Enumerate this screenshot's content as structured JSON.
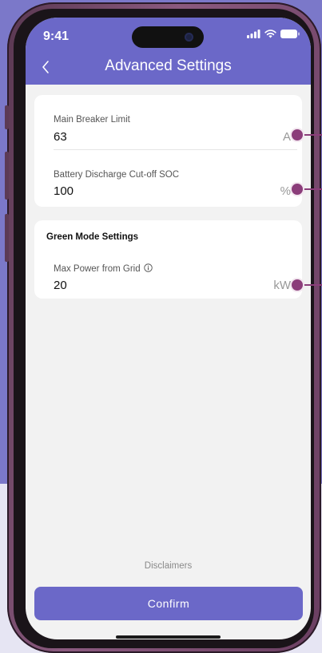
{
  "status_bar": {
    "time": "9:41",
    "icons": [
      "signal-bars-icon",
      "wifi-icon",
      "battery-icon"
    ]
  },
  "header": {
    "title": "Advanced Settings",
    "back_icon": "chevron-left-icon"
  },
  "settings_card": {
    "fields": [
      {
        "label": "Main Breaker Limit",
        "value": "63",
        "unit": "A"
      },
      {
        "label": "Battery Discharge Cut-off SOC",
        "value": "100",
        "unit": "%"
      }
    ]
  },
  "green_mode_card": {
    "title": "Green Mode Settings",
    "fields": [
      {
        "label": "Max Power from Grid",
        "value": "20",
        "unit": "kW",
        "info_icon": "info-circle-icon"
      }
    ]
  },
  "footer": {
    "disclaimers_label": "Disclaimers",
    "confirm_label": "Confirm"
  },
  "colors": {
    "brand": "#6b68c8",
    "background": "#7b78c9",
    "callout": "#8b3d7a"
  }
}
